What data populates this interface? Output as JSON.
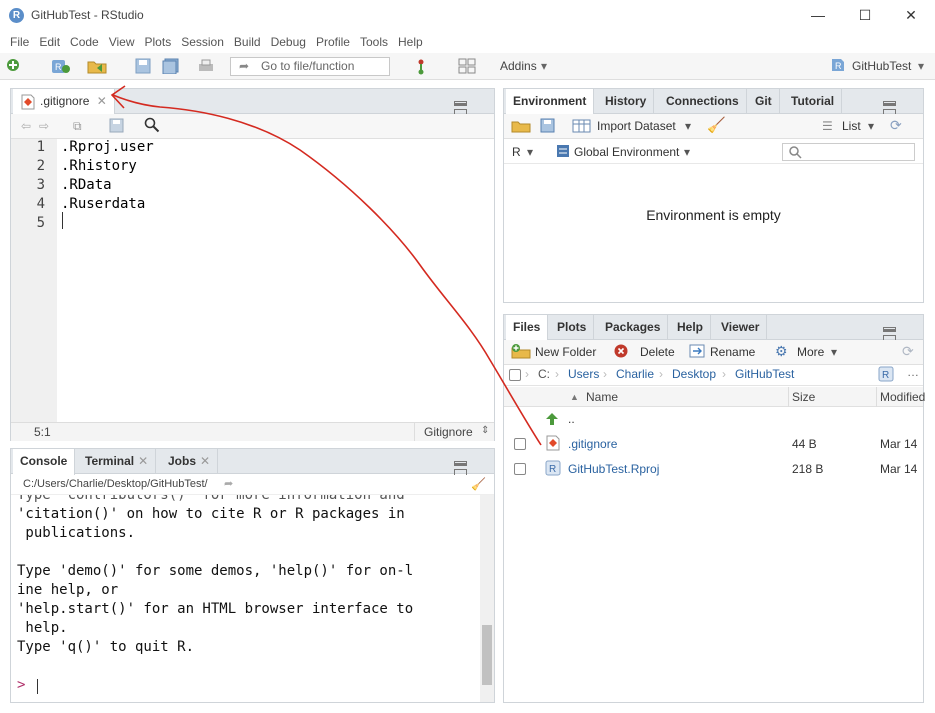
{
  "window": {
    "title": "GitHubTest - RStudio",
    "app_icon": "R",
    "minimize": "—",
    "maximize": "☐",
    "close": "✕"
  },
  "menubar": [
    "File",
    "Edit",
    "Code",
    "View",
    "Plots",
    "Session",
    "Build",
    "Debug",
    "Profile",
    "Tools",
    "Help"
  ],
  "toolbar": {
    "goto_placeholder": "Go to file/function",
    "addins": "Addins",
    "project": "GitHubTest"
  },
  "editor": {
    "tab": ".gitignore",
    "lines": [
      ".Rproj.user",
      ".Rhistory",
      ".RData",
      ".Ruserdata",
      ""
    ],
    "line_numbers": [
      "1",
      "2",
      "3",
      "4",
      "5"
    ],
    "position": "5:1",
    "filetype": "Gitignore"
  },
  "console": {
    "tabs": [
      "Console",
      "Terminal",
      "Jobs"
    ],
    "path": "C:/Users/Charlie/Desktop/GitHubTest/",
    "lines": [
      "Type 'contributors()' for more information and",
      "'citation()' on how to cite R or R packages in",
      " publications.",
      "",
      "Type 'demo()' for some demos, 'help()' for on-l",
      "ine help, or",
      "'help.start()' for an HTML browser interface to",
      " help.",
      "Type 'q()' to quit R.",
      "",
      ">"
    ]
  },
  "env_pane": {
    "tabs": [
      "Environment",
      "History",
      "Connections",
      "Git",
      "Tutorial"
    ],
    "import_dataset": "Import Dataset",
    "list": "List",
    "r_label": "R",
    "global_env": "Global Environment",
    "empty_message": "Environment is empty"
  },
  "files_pane": {
    "tabs": [
      "Files",
      "Plots",
      "Packages",
      "Help",
      "Viewer"
    ],
    "new_folder": "New Folder",
    "delete": "Delete",
    "rename": "Rename",
    "more": "More",
    "breadcrumb": [
      "C:",
      "Users",
      "Charlie",
      "Desktop",
      "GitHubTest"
    ],
    "columns": {
      "name": "Name",
      "size": "Size",
      "modified": "Modified"
    },
    "parent": "..",
    "files": [
      {
        "name": ".gitignore",
        "size": "44 B",
        "modified": "Mar 14"
      },
      {
        "name": "GitHubTest.Rproj",
        "size": "218 B",
        "modified": "Mar 14"
      }
    ]
  },
  "colors": {
    "annotation_arrow": "#d42a20",
    "accent": "#2a62a0"
  }
}
